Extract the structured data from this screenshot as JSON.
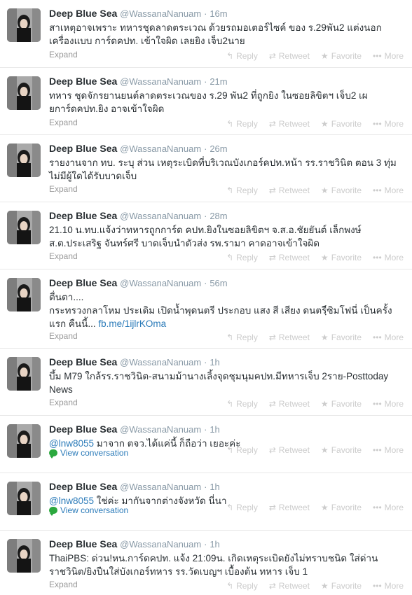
{
  "user": {
    "fullname": "Deep Blue Sea",
    "username": "@WassanaNanuam"
  },
  "labels": {
    "expand": "Expand",
    "view_conversation": "View conversation",
    "reply": "Reply",
    "retweet": "Retweet",
    "favorite": "Favorite",
    "more": "More"
  },
  "tweets": [
    {
      "time": "16m",
      "text": "สาเหตุอาจเพราะ ทหารชุดลาดตระเวณ ด้วยรถมอเตอร์ไซค์ ของ ร.29พัน2 แต่งนอกเครื่องแบบ การ์ดคปท. เข้าใจผิด เลยยิง เจ็บ2นาย"
    },
    {
      "time": "21m",
      "text": "ทหาร ชุดจักรยานยนต์ลาดตระเวณของ ร.29 พัน2 ที่ถูกยิง ในซอยลิขิตฯ เจ็บ2 เผยการ์ดคปท.ยิง อาจเข้าใจผิด"
    },
    {
      "time": "26m",
      "text": "รายงานจาก ทบ. ระบุ ส่วน เหตุระเบิดที่บริเวณบังเกอร์คปท.หน้า  รร.ราชวินิต ตอน 3 ทุ่ม ไม่มีผู้ใดได้รับบาดเจ็บ"
    },
    {
      "time": "28m",
      "text": "21.10 น.ทบ.แจ้งว่าทหารถูกการ์ด คปท.ยิงในซอยลิขิตฯ จ.ส.อ.ชัยยันต์  เล็กพงษ์ ส.ต.ประเสริฐ  จันทร์ศรี  บาดเจ็บนำตัวส่ง รพ.รามา คาดอาจเข้าใจผิด"
    },
    {
      "time": "56m",
      "text": "ตื่นตา....\nกระทรวงกลาโหม ประเดิม เปิดน้ำพุดนตรี ประกอบ แสง สี เสียง ดนตรีฺ์ซิมโฟนี่ เป็นครั้งแรก คืนนี้... ",
      "link": "fb.me/1ijlrKOma"
    },
    {
      "time": "1h",
      "text": "บึ้ม M79 ใกล้รร.ราชวินิต-สนามม้านางเลิ้งจุดชุมนุมคปท.มีทหารเจ็บ 2ราย-Posttoday News"
    },
    {
      "time": "1h",
      "mention": "@lnw8055",
      "text": " มาจาก ตจว.ได้แค่นี้ ก็ถือว่า เยอะค่ะ"
    },
    {
      "time": "1h",
      "mention": "@lnw8055",
      "text": " ใช่ค่ะ มากันจากต่างจังหวัด นี่นา"
    },
    {
      "time": "1h",
      "text": "ThaiPBS: ด่วน!หน.การ์ดคปท. แจ้ง 21:09น. เกิดเหตุระเบิดยังไม่ทราบชนิด ใส่ด่านราชวินิต/ยิงปืนใส่บังเกอร์ทหาร รร.วัดเบญฯ เบื้องต้น ทหาร เจ็บ 1"
    }
  ]
}
